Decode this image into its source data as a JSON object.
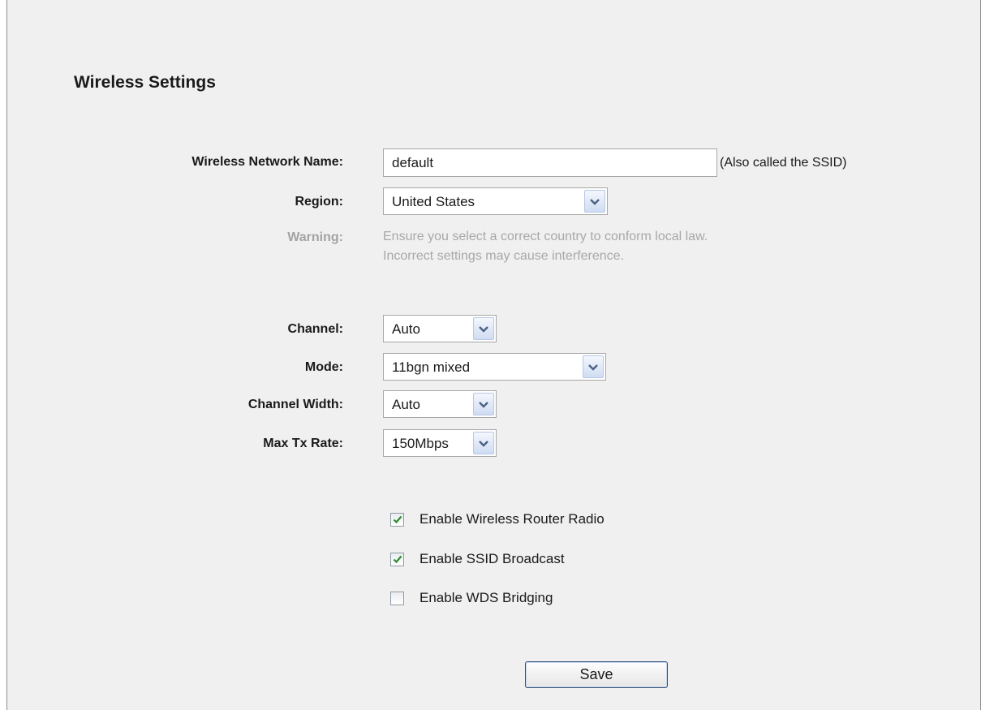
{
  "page": {
    "title": "Wireless Settings"
  },
  "form": {
    "network_name": {
      "label": "Wireless Network Name:",
      "value": "default",
      "hint": "(Also called the SSID)"
    },
    "region": {
      "label": "Region:",
      "value": "United States"
    },
    "warning": {
      "label": "Warning:",
      "line1": "Ensure you select a correct country to conform local law.",
      "line2": "Incorrect settings may cause interference."
    },
    "channel": {
      "label": "Channel:",
      "value": "Auto"
    },
    "mode": {
      "label": "Mode:",
      "value": "11bgn mixed"
    },
    "channel_width": {
      "label": "Channel Width:",
      "value": "Auto"
    },
    "max_tx_rate": {
      "label": "Max Tx Rate:",
      "value": "150Mbps"
    }
  },
  "options": [
    {
      "label": "Enable Wireless Router Radio",
      "checked": true
    },
    {
      "label": "Enable SSID Broadcast",
      "checked": true
    },
    {
      "label": "Enable WDS Bridging",
      "checked": false
    }
  ],
  "actions": {
    "save_label": "Save"
  },
  "colors": {
    "background": "#f0f0f0",
    "muted_text": "#a3a3a3",
    "check_mark": "#2e8b2e",
    "button_border": "#33507c"
  },
  "icons": {
    "dropdown": "chevron-down-icon",
    "check": "check-icon"
  }
}
